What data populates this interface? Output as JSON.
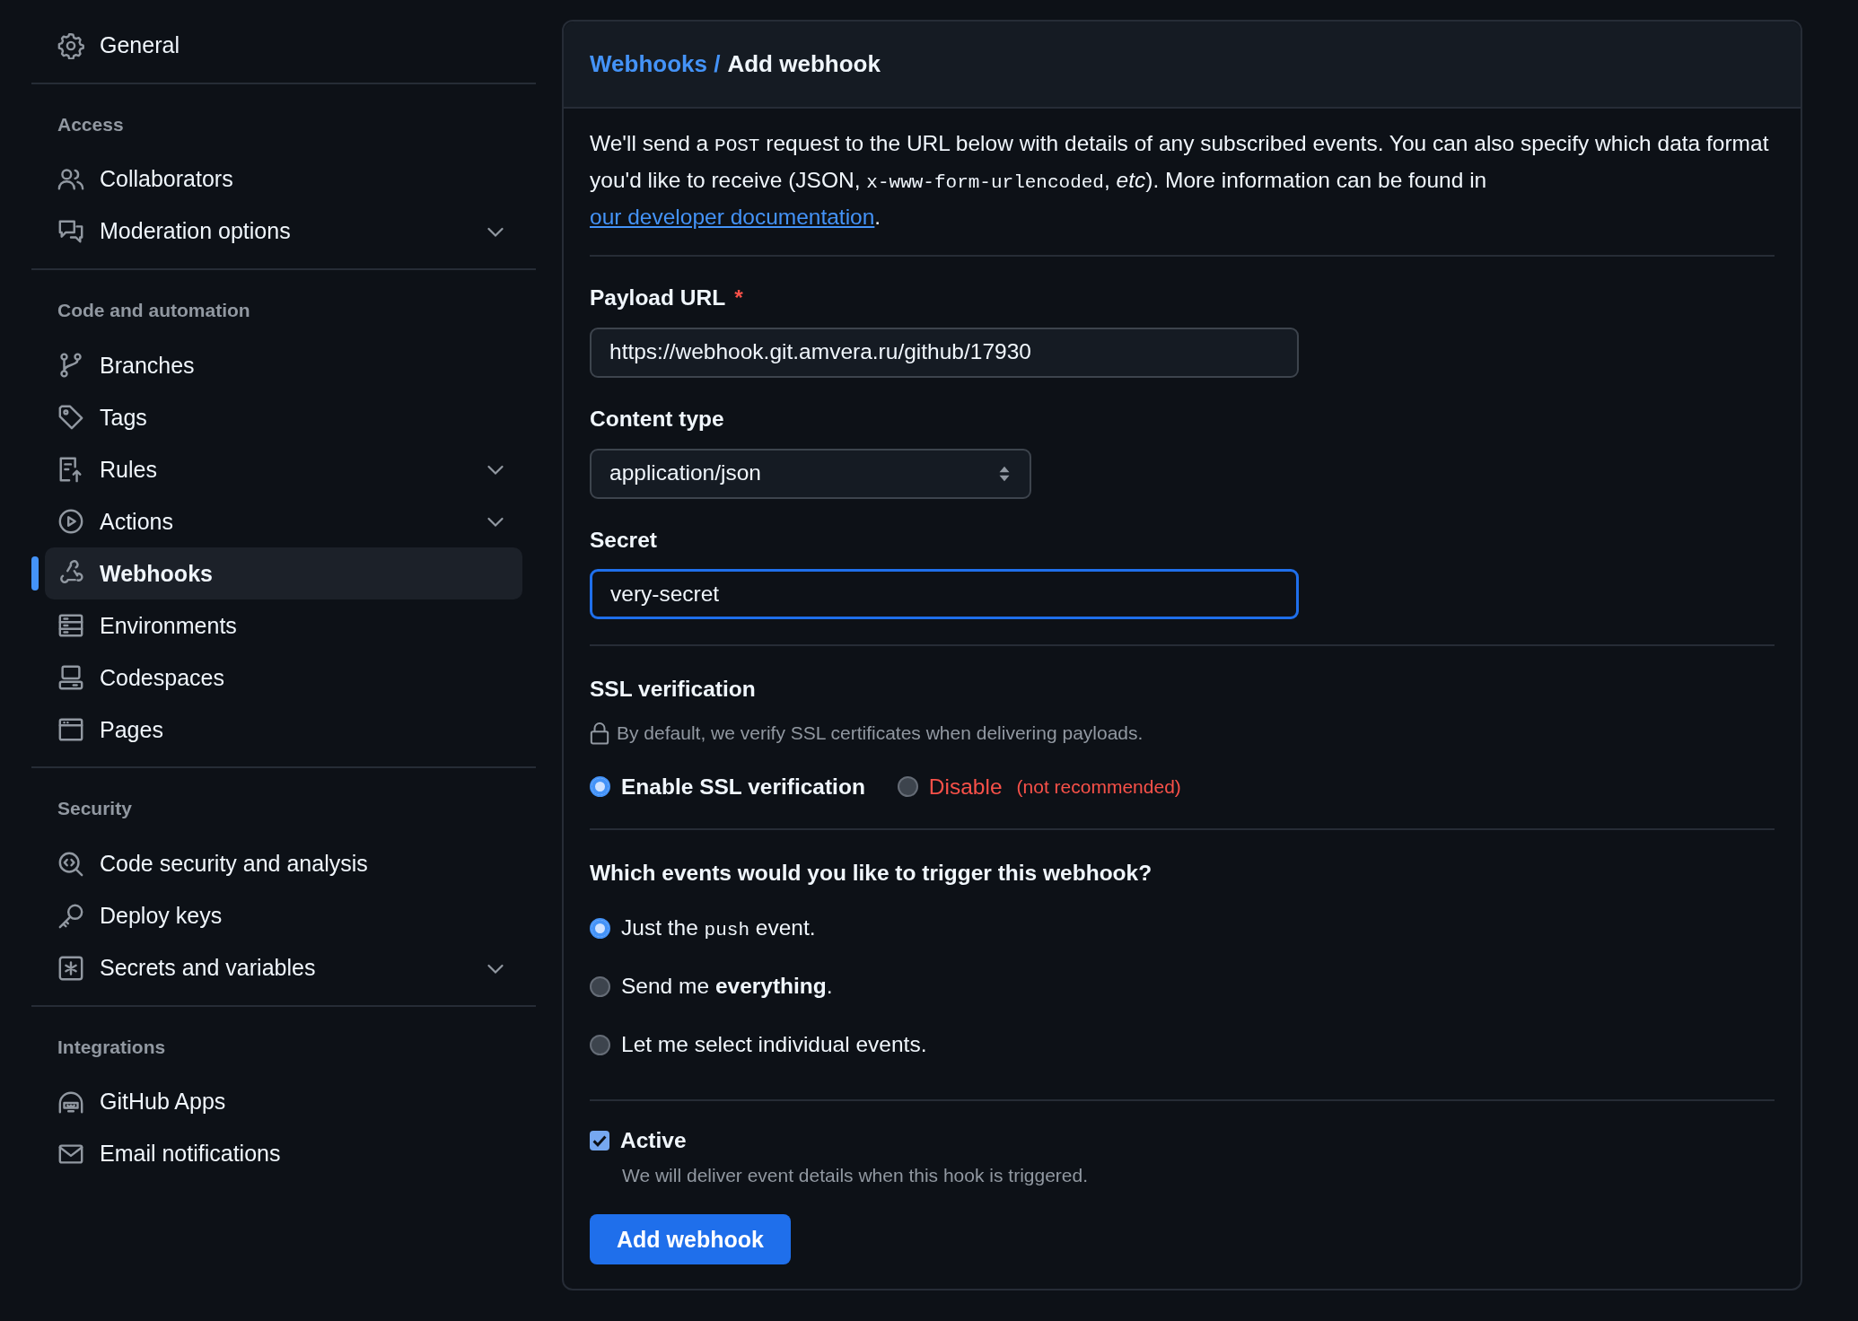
{
  "sidebar": {
    "sections": [
      {
        "items": [
          {
            "label": "General",
            "selected": false,
            "expandable": false
          }
        ]
      },
      {
        "title": "Access",
        "items": [
          {
            "label": "Collaborators",
            "selected": false,
            "expandable": false
          },
          {
            "label": "Moderation options",
            "selected": false,
            "expandable": true
          }
        ]
      },
      {
        "title": "Code and automation",
        "items": [
          {
            "label": "Branches",
            "selected": false,
            "expandable": false
          },
          {
            "label": "Tags",
            "selected": false,
            "expandable": false
          },
          {
            "label": "Rules",
            "selected": false,
            "expandable": true
          },
          {
            "label": "Actions",
            "selected": false,
            "expandable": true
          },
          {
            "label": "Webhooks",
            "selected": true,
            "expandable": false
          },
          {
            "label": "Environments",
            "selected": false,
            "expandable": false
          },
          {
            "label": "Codespaces",
            "selected": false,
            "expandable": false
          },
          {
            "label": "Pages",
            "selected": false,
            "expandable": false
          }
        ]
      },
      {
        "title": "Security",
        "items": [
          {
            "label": "Code security and analysis",
            "selected": false,
            "expandable": false
          },
          {
            "label": "Deploy keys",
            "selected": false,
            "expandable": false
          },
          {
            "label": "Secrets and variables",
            "selected": false,
            "expandable": true
          }
        ]
      },
      {
        "title": "Integrations",
        "items": [
          {
            "label": "GitHub Apps",
            "selected": false,
            "expandable": false
          },
          {
            "label": "Email notifications",
            "selected": false,
            "expandable": false
          }
        ]
      }
    ]
  },
  "breadcrumb": {
    "parent": "Webhooks /",
    "current": "Add webhook"
  },
  "intro": [
    {
      "kind": "text",
      "text": "We'll send a "
    },
    {
      "kind": "code",
      "text": "POST"
    },
    {
      "kind": "text",
      "text": " request to the URL below with details of any subscribed events. You can also specify which data format you'd like to receive (JSON, "
    },
    {
      "kind": "code",
      "text": "x-www-form-urlencoded"
    },
    {
      "kind": "text",
      "text": ", *etc*). More information can be found in "
    },
    {
      "kind": "link",
      "text": "our developer documentation"
    },
    {
      "kind": "text",
      "text": "."
    }
  ],
  "payload_url": {
    "label": "Payload URL",
    "required_mark": "*",
    "value": "https://webhook.git.amvera.ru/github/17930"
  },
  "content_type": {
    "label": "Content type",
    "value": "application/json"
  },
  "secret": {
    "label": "Secret",
    "value": "very-secret",
    "focused": true
  },
  "ssl": {
    "title": "SSL verification",
    "note": "By default, we verify SSL certificates when delivering payloads.",
    "options": [
      {
        "label": "Enable SSL verification",
        "selected": true,
        "kind": "normal"
      },
      {
        "label": "Disable",
        "note": "(not recommended)",
        "selected": false,
        "kind": "danger"
      }
    ]
  },
  "events": {
    "title": "Which events would you like to trigger this webhook?",
    "options": [
      {
        "selected": true,
        "parts": [
          {
            "kind": "text",
            "text": "Just the "
          },
          {
            "kind": "code",
            "text": "push"
          },
          {
            "kind": "text",
            "text": " event."
          }
        ]
      },
      {
        "selected": false,
        "parts": [
          {
            "kind": "text",
            "text": "Send me **everything**."
          }
        ]
      },
      {
        "selected": false,
        "parts": [
          {
            "kind": "text",
            "text": "Let me select individual events."
          }
        ]
      }
    ]
  },
  "active": {
    "label": "Active",
    "checked": true,
    "description": "We will deliver event details when this hook is triggered."
  },
  "submit": "Add webhook"
}
